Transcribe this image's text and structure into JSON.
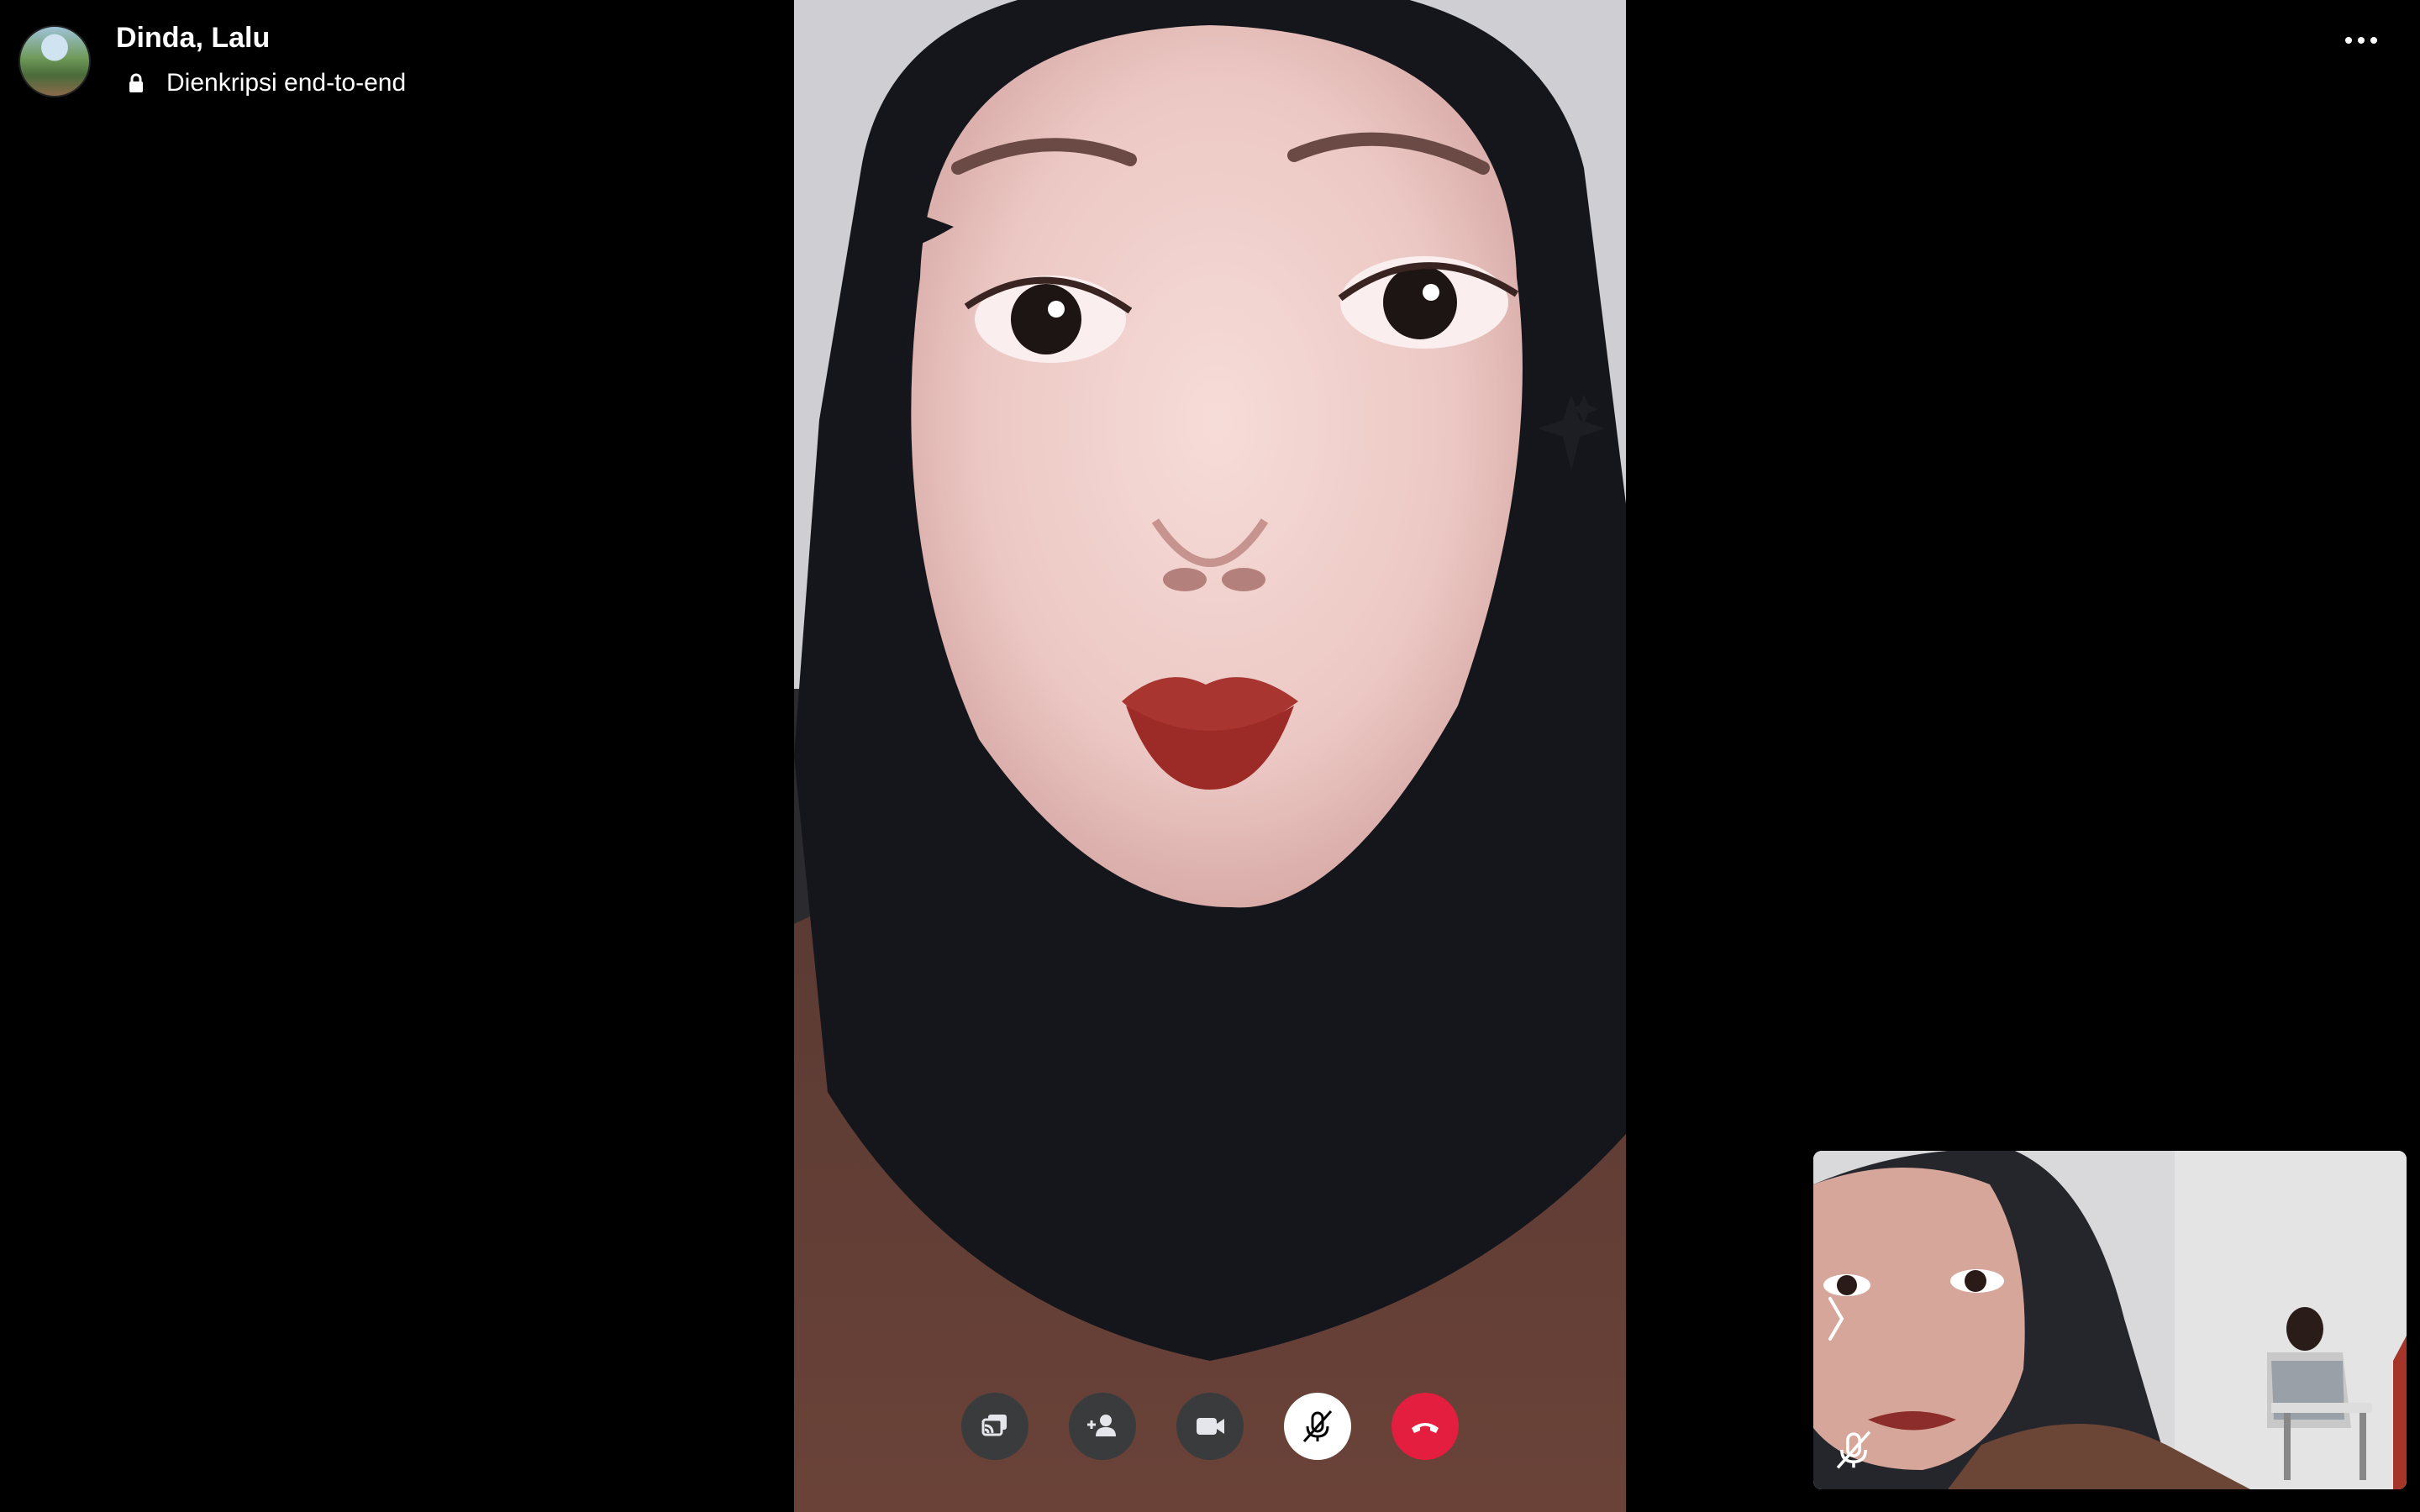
{
  "header": {
    "contact_name": "Dinda, Lalu",
    "encryption_status": "Dienkripsi end-to-end",
    "avatar_icon": "avatar-icon",
    "lock_icon": "lock-icon",
    "more_icon": "more-options-icon"
  },
  "main_video": {
    "participant": "remote-participant-video"
  },
  "self_view": {
    "expand_icon": "chevron-right-icon",
    "mic_status_icon": "microphone-muted-icon"
  },
  "controls": [
    {
      "icon": "share-screen-icon"
    },
    {
      "icon": "add-person-icon"
    },
    {
      "icon": "video-camera-icon"
    },
    {
      "icon": "microphone-muted-icon"
    },
    {
      "icon": "end-call-icon"
    }
  ],
  "colors": {
    "background": "#000000",
    "control_bg": "#3a3b3c",
    "end_call": "#e41e3f",
    "mute_active": "#ffffff"
  }
}
